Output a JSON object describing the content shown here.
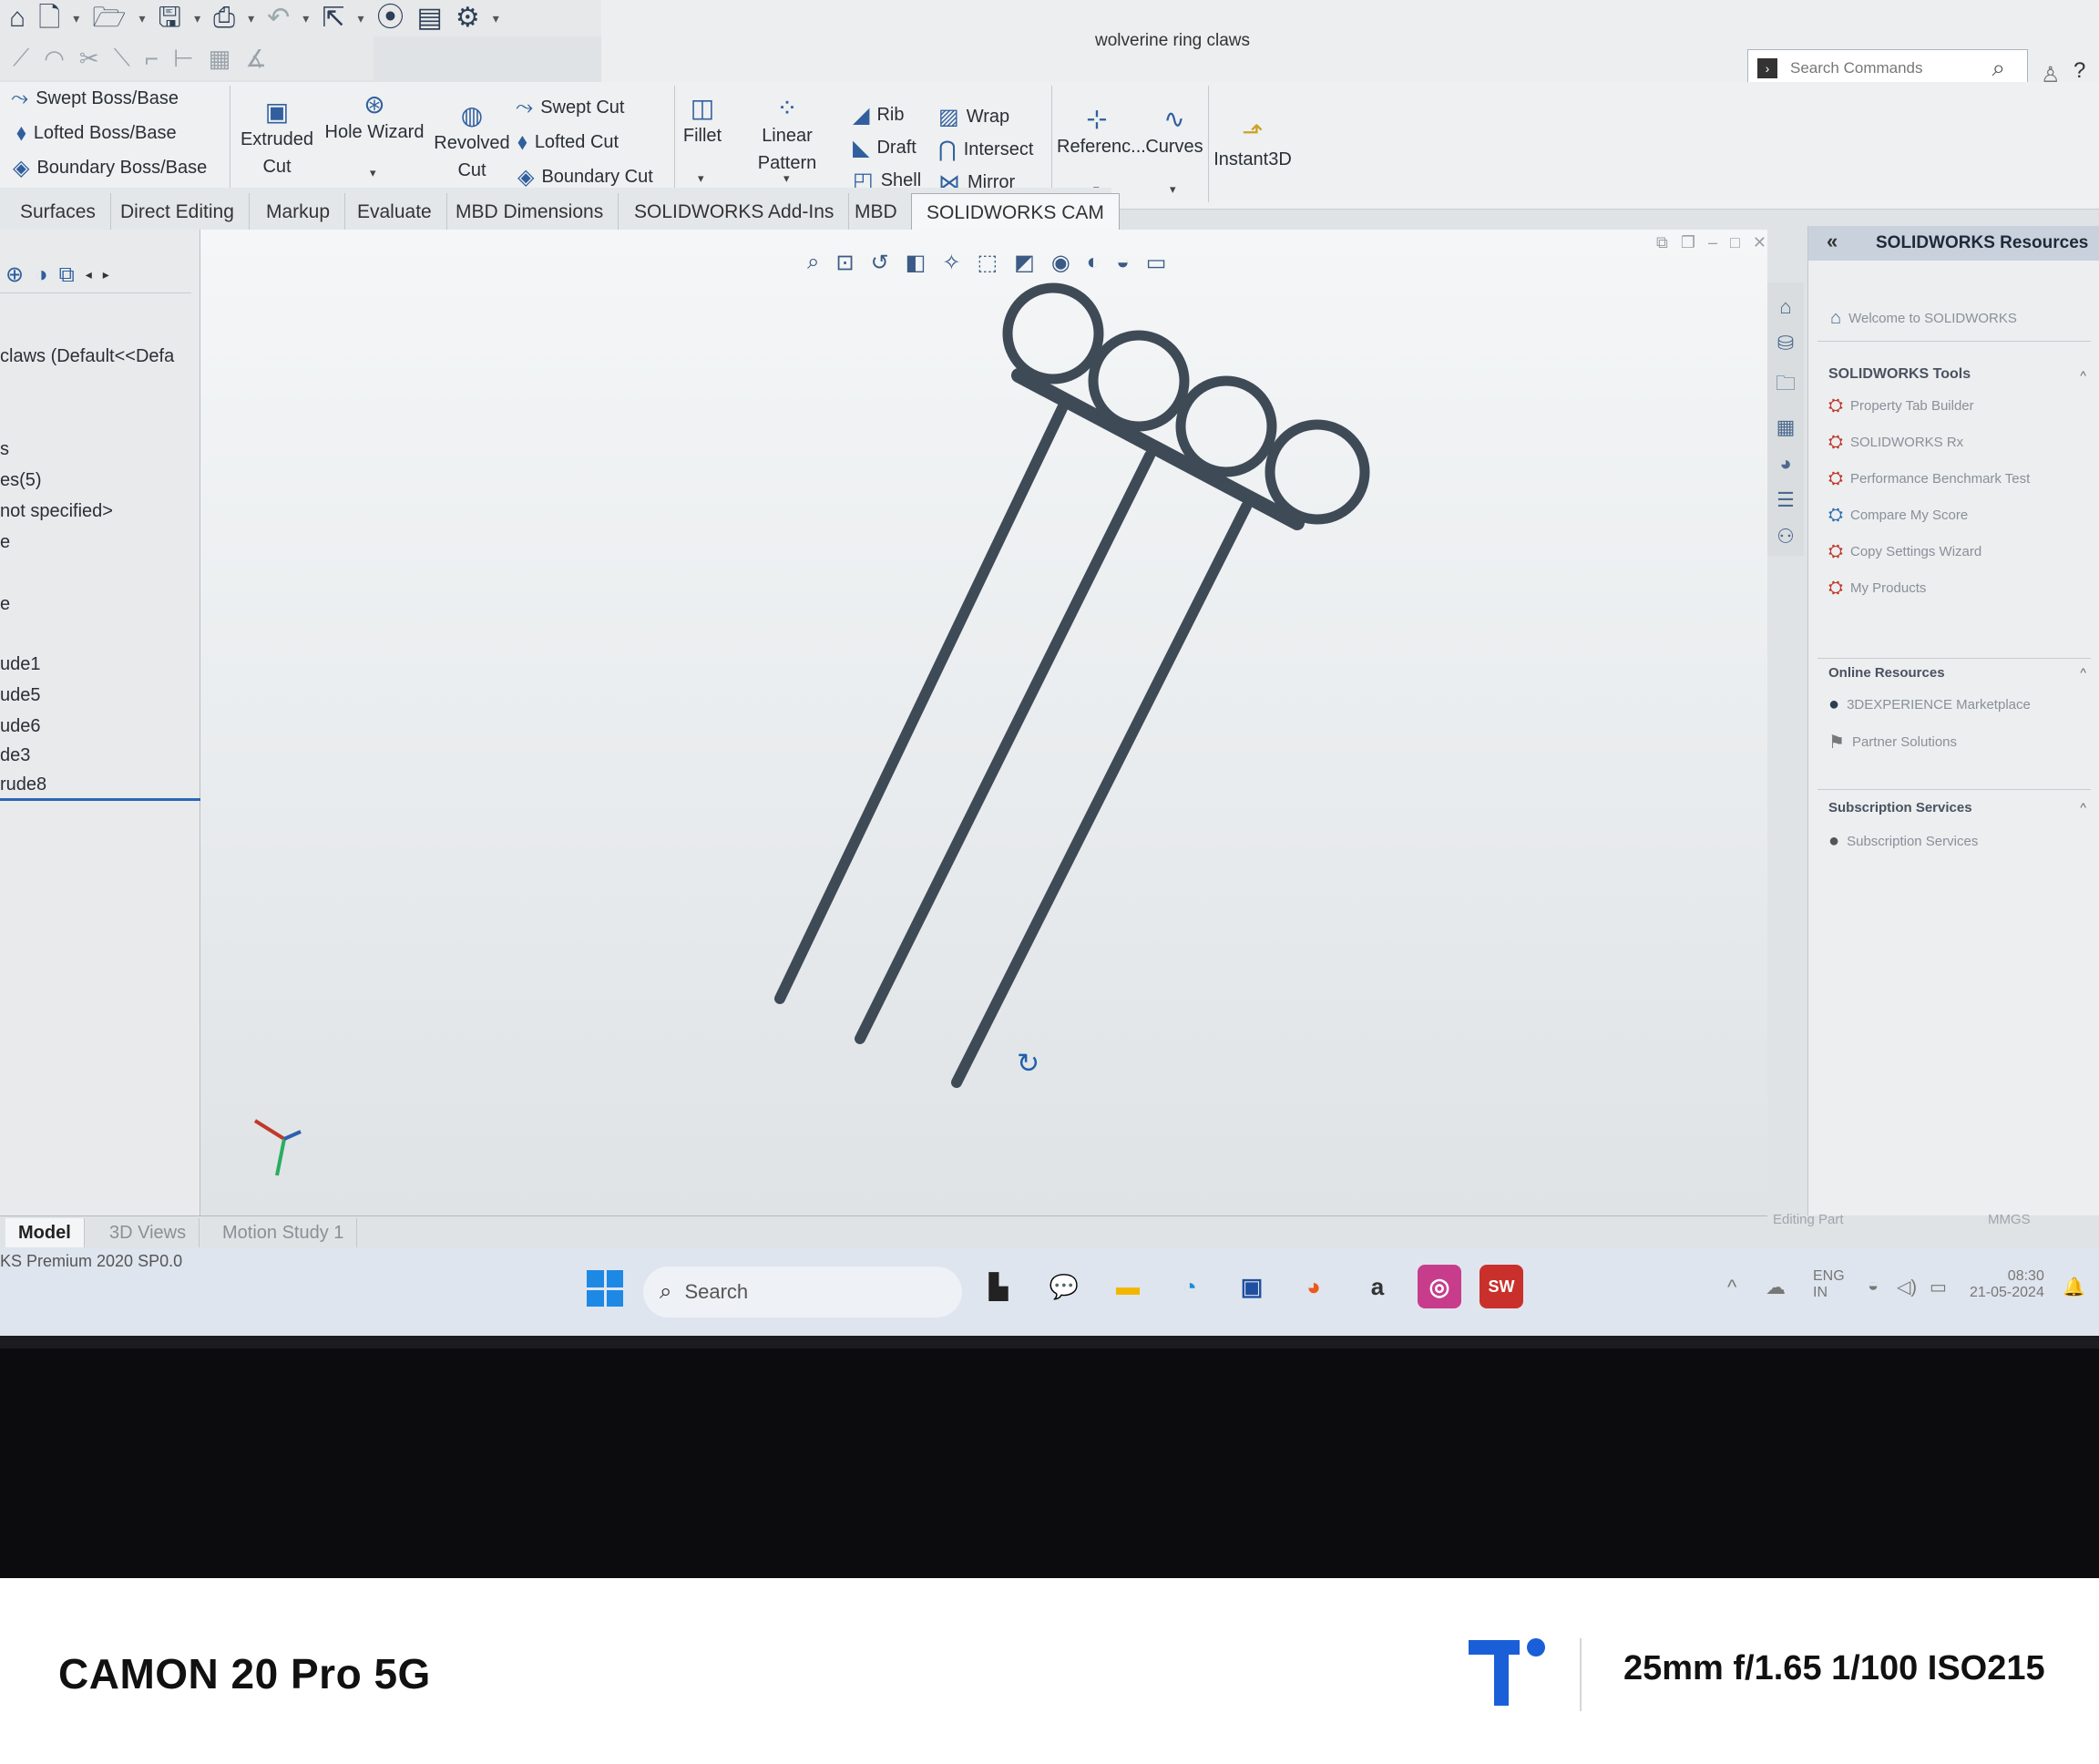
{
  "window": {
    "title": "wolverine ring claws"
  },
  "quick_access": {
    "icons": [
      "home-icon",
      "new-doc-icon",
      "open-icon",
      "save-icon",
      "print-icon",
      "undo-icon",
      "select-icon",
      "traffic-light-icon",
      "file-props-icon",
      "options-gear-icon"
    ]
  },
  "search": {
    "placeholder": "Search Commands"
  },
  "ribbon": {
    "swept_boss": "Swept Boss/Base",
    "lofted_boss": "Lofted Boss/Base",
    "boundary_boss": "Boundary Boss/Base",
    "extruded_cut": "Extruded Cut",
    "extruded_cut_1": "Extruded",
    "extruded_cut_2": "Cut",
    "hole_wizard": "Hole Wizard",
    "revolved_cut_1": "Revolved",
    "revolved_cut_2": "Cut",
    "swept_cut": "Swept Cut",
    "lofted_cut": "Lofted Cut",
    "boundary_cut": "Boundary Cut",
    "fillet": "Fillet",
    "linear_pattern": "Linear Pattern",
    "rib": "Rib",
    "draft": "Draft",
    "shell": "Shell",
    "wrap": "Wrap",
    "intersect": "Intersect",
    "mirror": "Mirror",
    "reference": "Referenc...",
    "curves": "Curves",
    "instant3d": "Instant3D"
  },
  "tabs": [
    "Surfaces",
    "Direct Editing",
    "Markup",
    "Evaluate",
    "MBD Dimensions",
    "SOLIDWORKS Add-Ins",
    "MBD",
    "SOLIDWORKS CAM"
  ],
  "feature_tree": {
    "root": "claws  (Default<<Defa",
    "items": [
      "s",
      "es(5)",
      "not specified>",
      "e",
      "e",
      "ude1",
      "ude5",
      "ude6",
      "de3",
      "rude8"
    ]
  },
  "task_pane": {
    "title": "SOLIDWORKS Resources",
    "welcome": "Welcome to SOLIDWORKS",
    "tools_title": "SOLIDWORKS Tools",
    "tools": [
      "Property Tab Builder",
      "SOLIDWORKS Rx",
      "Performance Benchmark Test",
      "Compare My Score",
      "Copy Settings Wizard",
      "My Products"
    ],
    "online_title": "Online Resources",
    "online": [
      "3DEXPERIENCE Marketplace",
      "Partner Solutions"
    ],
    "subs_title": "Subscription Services",
    "subs": [
      "Subscription Services"
    ]
  },
  "bottom_tabs": [
    "Model",
    "3D Views",
    "Motion Study 1"
  ],
  "status": {
    "version": "KS Premium 2020 SP0.0",
    "editing": "Editing Part",
    "units": "MMGS"
  },
  "taskbar": {
    "search": "Search",
    "lang": "ENG",
    "region": "IN",
    "time": "08:30",
    "date": "21-05-2024"
  },
  "camera_watermark": {
    "model": "CAMON 20 Pro 5G",
    "exif": "25mm f/1.65 1/100 ISO215"
  },
  "colors": {
    "model_body": "#3f4a57",
    "accent": "#2b66b5",
    "taskbar": "#dfe5ee"
  }
}
